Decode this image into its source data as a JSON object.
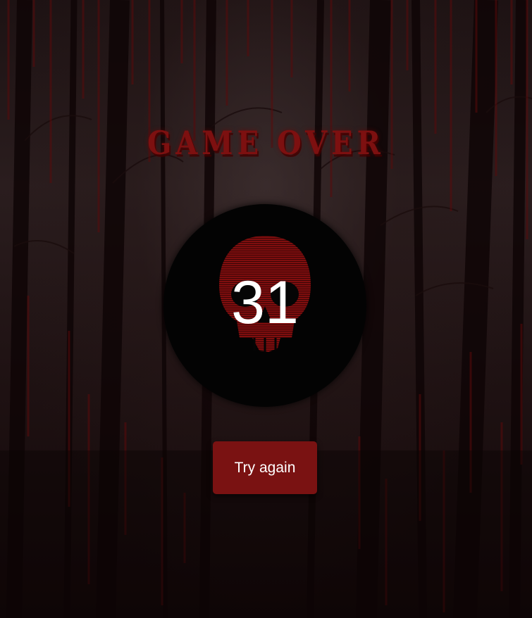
{
  "game_over": {
    "title": "GAME OVER",
    "score": "31",
    "try_again_label": "Try again"
  },
  "theme": {
    "accent": "#7a1212",
    "title_color": "#7d1010",
    "background": "#1d1213",
    "disc": "#030303",
    "skull": "#8b0f0f"
  },
  "decorations": {
    "background_icon": "dark-forest-icon",
    "drip_icon": "blood-drip-icon",
    "score_icon": "skull-icon"
  }
}
